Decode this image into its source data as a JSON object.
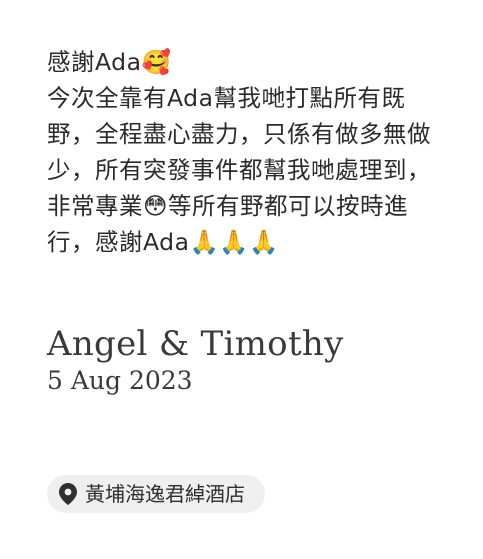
{
  "testimonial": {
    "lines": [
      "感謝Ada🥰",
      "今次全靠有Ada幫我哋打點所有既野，全程盡心盡力，只係有做多無做少，所有突發事件都幫我哋處理到，非常專業😳等所有野都可以按時進行，感謝Ada🙏🙏🙏"
    ]
  },
  "author": {
    "names": "Angel & Timothy",
    "date": "5 Aug 2023"
  },
  "location": {
    "icon": "map-pin-icon",
    "label": "黃埔海逸君綽酒店"
  }
}
